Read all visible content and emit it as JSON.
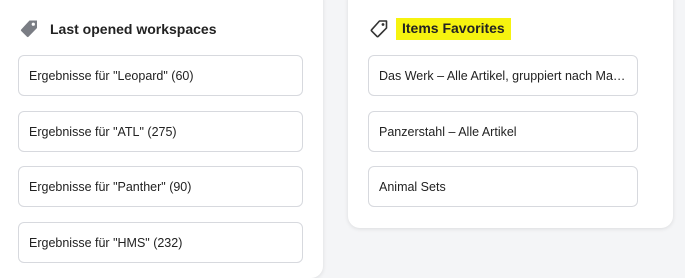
{
  "last_opened": {
    "title": "Last opened workspaces",
    "items": [
      "Ergebnisse für \"Leopard\" (60)",
      "Ergebnisse für \"ATL\" (275)",
      "Ergebnisse für \"Panther\" (90)",
      "Ergebnisse für \"HMS\" (232)"
    ]
  },
  "favorites": {
    "title": "Items Favorites",
    "items": [
      "Das Werk – Alle Artikel, gruppiert nach Material",
      "Panzerstahl – Alle Artikel",
      "Animal Sets"
    ]
  },
  "icons": {
    "last_opened": "tag-filled-icon",
    "favorites": "tag-outline-icon"
  },
  "colors": {
    "highlight": "#f6f30f",
    "icon_gray": "#7a7d84"
  }
}
